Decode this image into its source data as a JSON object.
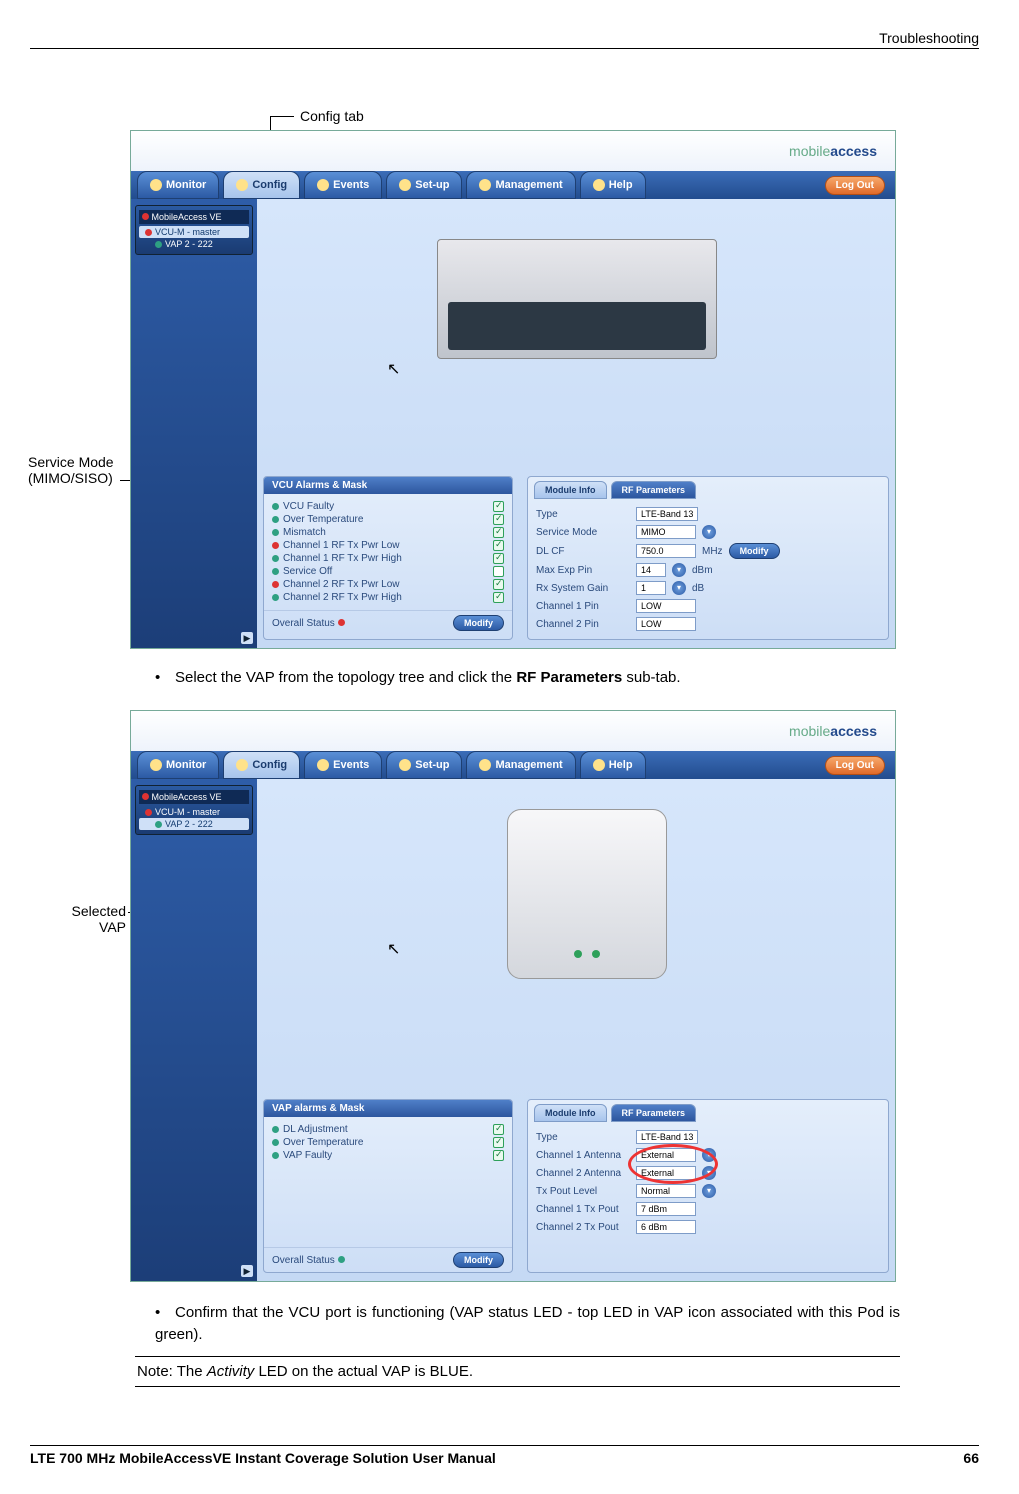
{
  "header": {
    "section": "Troubleshooting"
  },
  "footer": {
    "title": "LTE 700 MHz MobileAccessVE Instant Coverage Solution User Manual",
    "page": "66"
  },
  "callouts": {
    "config_tab": "Config tab",
    "service_mode_l1": "Service Mode",
    "service_mode_l2": "(MIMO/SISO)",
    "selected_vap_l1": "Selected",
    "selected_vap_l2": "VAP"
  },
  "nav": {
    "monitor": "Monitor",
    "config": "Config",
    "events": "Events",
    "setup": "Set-up",
    "management": "Management",
    "help": "Help",
    "logout": "Log Out"
  },
  "brand": {
    "part1": "mobile",
    "part2": "access"
  },
  "tree": {
    "root": "MobileAccess VE",
    "vcu": "VCU-M - master",
    "vap": "VAP 2 - 222"
  },
  "panel_titles": {
    "vcu_alarms": "VCU Alarms & Mask",
    "vap_alarms": "VAP alarms & Mask",
    "module_info": "Module Info",
    "rf_params": "RF Parameters",
    "overall": "Overall Status",
    "modify": "Modify"
  },
  "vcu_alarms": [
    {
      "label": "VCU Faulty",
      "color": "green",
      "mask": true
    },
    {
      "label": "Over Temperature",
      "color": "green",
      "mask": true
    },
    {
      "label": "Mismatch",
      "color": "green",
      "mask": true
    },
    {
      "label": "Channel 1 RF Tx Pwr Low",
      "color": "red",
      "mask": true
    },
    {
      "label": "Channel 1 RF Tx Pwr High",
      "color": "green",
      "mask": true
    },
    {
      "label": "Service Off",
      "color": "green",
      "mask": false
    },
    {
      "label": "Channel 2 RF Tx Pwr Low",
      "color": "red",
      "mask": true
    },
    {
      "label": "Channel 2 RF Tx Pwr High",
      "color": "green",
      "mask": true
    }
  ],
  "vcu_rf": {
    "type_label": "Type",
    "type_val": "LTE-Band 13",
    "svc_label": "Service Mode",
    "svc_val": "MIMO",
    "dlcf_label": "DL CF",
    "dlcf_val": "750.0",
    "dlcf_unit": "MHz",
    "maxpin_label": "Max Exp Pin",
    "maxpin_val": "14",
    "maxpin_unit": "dBm",
    "rxgain_label": "Rx System Gain",
    "rxgain_val": "1",
    "rxgain_unit": "dB",
    "ch1pin_label": "Channel 1 Pin",
    "ch1pin_val": "LOW",
    "ch2pin_label": "Channel 2 Pin",
    "ch2pin_val": "LOW"
  },
  "vap_alarms": [
    {
      "label": "DL Adjustment",
      "color": "green",
      "mask": true
    },
    {
      "label": "Over Temperature",
      "color": "green",
      "mask": true
    },
    {
      "label": "VAP Faulty",
      "color": "green",
      "mask": true
    }
  ],
  "vap_rf": {
    "type_label": "Type",
    "type_val": "LTE-Band 13",
    "ch1a_label": "Channel 1 Antenna",
    "ch1a_val": "External",
    "ch2a_label": "Channel 2 Antenna",
    "ch2a_val": "External",
    "txlvl_label": "Tx Pout Level",
    "txlvl_val": "Normal",
    "ch1tx_label": "Channel 1 Tx Pout",
    "ch1tx_val": "7 dBm",
    "ch2tx_label": "Channel 2 Tx Pout",
    "ch2tx_val": "6 dBm"
  },
  "body": {
    "bullet1_a": "Select the VAP from the topology tree and click the ",
    "bullet1_b": "RF Parameters",
    "bullet1_c": " sub-tab.",
    "bullet2": "Confirm that the VCU port is functioning (VAP status LED - top LED in VAP icon associated with this Pod is green).",
    "note_a": "Note: The ",
    "note_b": "Activity",
    "note_c": " LED on the actual VAP is BLUE."
  }
}
